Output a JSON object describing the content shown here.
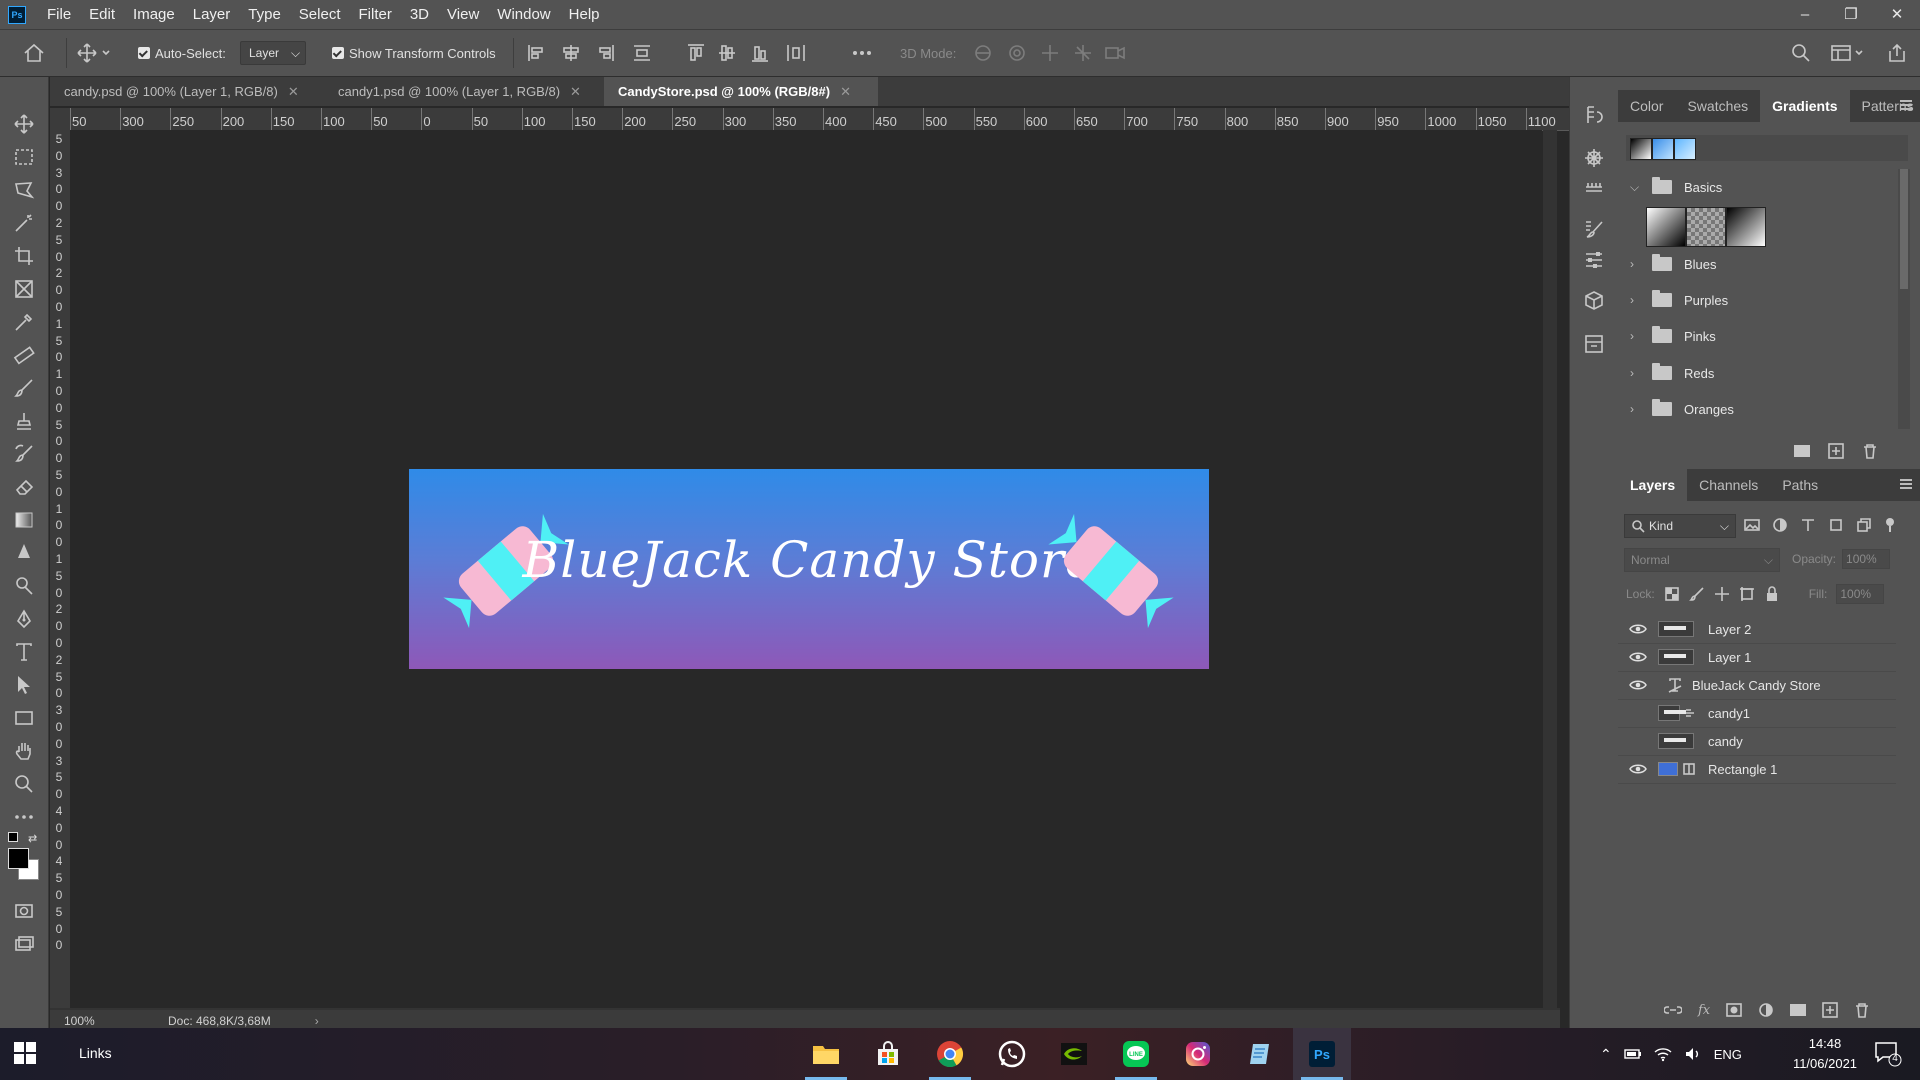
{
  "app": {
    "logo": "Ps"
  },
  "menu": [
    "File",
    "Edit",
    "Image",
    "Layer",
    "Type",
    "Select",
    "Filter",
    "3D",
    "View",
    "Window",
    "Help"
  ],
  "options": {
    "auto_select_label": "Auto-Select:",
    "auto_select_value": "Layer",
    "transform_label": "Show Transform Controls",
    "mode_label": "3D Mode:"
  },
  "tabs": [
    {
      "label": "candy.psd @ 100% (Layer 1, RGB/8)",
      "active": false
    },
    {
      "label": "candy1.psd @ 100% (Layer 1, RGB/8)",
      "active": false
    },
    {
      "label": "CandyStore.psd @ 100% (RGB/8#)",
      "active": true
    }
  ],
  "ruler_h": [
    "50",
    "300",
    "250",
    "200",
    "150",
    "100",
    "50",
    "0",
    "50",
    "100",
    "150",
    "200",
    "250",
    "300",
    "350",
    "400",
    "450",
    "500",
    "550",
    "600",
    "650",
    "700",
    "750",
    "800",
    "850",
    "900",
    "950",
    "1000",
    "1050",
    "1100"
  ],
  "ruler_v": [
    "5",
    "0",
    "3",
    "0",
    "0",
    "2",
    "5",
    "0",
    "2",
    "0",
    "0",
    "1",
    "5",
    "0",
    "1",
    "0",
    "0",
    "5",
    "0",
    "0",
    "5",
    "0",
    "1",
    "0",
    "0",
    "1",
    "5",
    "0",
    "2",
    "0",
    "0",
    "2",
    "5",
    "0",
    "3",
    "0",
    "0",
    "3",
    "5",
    "0",
    "4",
    "0",
    "0",
    "4",
    "5",
    "0",
    "5",
    "0",
    "0"
  ],
  "artwork": {
    "title": "BlueJack Candy Store",
    "colors": {
      "top": "#2f8be8",
      "bottom": "#8e58b8",
      "candy_cyan": "#4ff0f5",
      "candy_pink": "#f7b9d3"
    }
  },
  "status": {
    "zoom": "100%",
    "doc": "Doc: 468,8K/3,68M"
  },
  "gradients_panel": {
    "tabs": [
      "Color",
      "Swatches",
      "Gradients",
      "Patterns"
    ],
    "active_tab": "Gradients",
    "groups": [
      {
        "name": "Basics",
        "expanded": true
      },
      {
        "name": "Blues",
        "expanded": false
      },
      {
        "name": "Purples",
        "expanded": false
      },
      {
        "name": "Pinks",
        "expanded": false
      },
      {
        "name": "Reds",
        "expanded": false
      },
      {
        "name": "Oranges",
        "expanded": false
      }
    ]
  },
  "layers_panel": {
    "tabs": [
      "Layers",
      "Channels",
      "Paths"
    ],
    "active_tab": "Layers",
    "filter_kind": "Kind",
    "blend_mode": "Normal",
    "opacity_label": "Opacity:",
    "opacity_value": "100%",
    "lock_label": "Lock:",
    "fill_label": "Fill:",
    "fill_value": "100%",
    "layers": [
      {
        "name": "Layer 2",
        "visible": true,
        "type": "pixel"
      },
      {
        "name": "Layer 1",
        "visible": true,
        "type": "pixel"
      },
      {
        "name": "BlueJack Candy Store",
        "visible": true,
        "type": "text"
      },
      {
        "name": "candy1",
        "visible": false,
        "type": "linked"
      },
      {
        "name": "candy",
        "visible": false,
        "type": "pixel"
      },
      {
        "name": "Rectangle 1",
        "visible": true,
        "type": "shape"
      }
    ]
  },
  "taskbar": {
    "links_label": "Links",
    "apps": [
      "file-explorer",
      "microsoft-store",
      "chrome",
      "whatsapp",
      "nvidia",
      "line",
      "instagram",
      "notepad",
      "photoshop"
    ],
    "lang": "ENG",
    "time": "14:48",
    "date": "11/06/2021",
    "notifications": "4"
  }
}
